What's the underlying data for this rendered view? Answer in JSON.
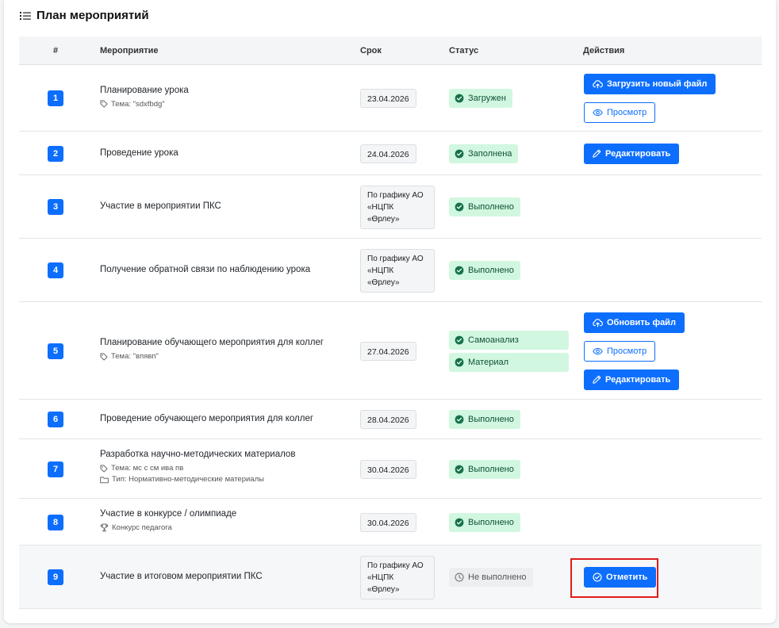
{
  "card": {
    "title": "План мероприятий"
  },
  "columns": {
    "num": "#",
    "event": "Мероприятие",
    "deadline": "Срок",
    "status": "Статус",
    "actions": "Действия"
  },
  "rows": [
    {
      "num": "1",
      "name": "Планирование урока",
      "meta": [
        {
          "icon": "tag-icon",
          "text": "Тема: \"sdxfbdg\""
        }
      ],
      "deadline": "23.04.2026",
      "statuses": [
        {
          "icon": "check-circle-icon",
          "text": "Загружен"
        }
      ],
      "actions": [
        {
          "icon": "cloud-upload-icon",
          "label": "Загрузить новый файл",
          "style": "primary"
        },
        {
          "icon": "eye-icon",
          "label": "Просмотр",
          "style": "outline"
        }
      ]
    },
    {
      "num": "2",
      "name": "Проведение урока",
      "meta": [],
      "deadline": "24.04.2026",
      "statuses": [
        {
          "icon": "check-circle-icon",
          "text": "Заполнена"
        }
      ],
      "actions": [
        {
          "icon": "pencil-icon",
          "label": "Редактировать",
          "style": "primary"
        }
      ]
    },
    {
      "num": "3",
      "name": "Участие в мероприятии ПКС",
      "meta": [],
      "deadline": "По графику АО «НЦПК «Өрлеу»",
      "statuses": [
        {
          "icon": "check-circle-icon",
          "text": "Выполнено"
        }
      ],
      "actions": []
    },
    {
      "num": "4",
      "name": "Получение обратной связи по наблюдению урока",
      "meta": [],
      "deadline": "По графику АО «НЦПК «Өрлеу»",
      "statuses": [
        {
          "icon": "check-circle-icon",
          "text": "Выполнено"
        }
      ],
      "actions": []
    },
    {
      "num": "5",
      "name": "Планирование обучающего мероприятия для коллег",
      "meta": [
        {
          "icon": "tag-icon",
          "text": "Тема: \"впявп\""
        }
      ],
      "deadline": "27.04.2026",
      "statuses": [
        {
          "icon": "check-circle-icon",
          "text": "Самоанализ"
        },
        {
          "icon": "check-circle-icon",
          "text": "Материал"
        }
      ],
      "actions": [
        {
          "icon": "cloud-upload-icon",
          "label": "Обновить файл",
          "style": "primary"
        },
        {
          "icon": "eye-icon",
          "label": "Просмотр",
          "style": "outline"
        },
        {
          "icon": "pencil-icon",
          "label": "Редактировать",
          "style": "primary"
        }
      ]
    },
    {
      "num": "6",
      "name": "Проведение обучающего мероприятия для коллег",
      "meta": [],
      "deadline": "28.04.2026",
      "statuses": [
        {
          "icon": "check-circle-icon",
          "text": "Выполнено"
        }
      ],
      "actions": []
    },
    {
      "num": "7",
      "name": "Разработка научно-методических материалов",
      "meta": [
        {
          "icon": "tag-icon",
          "text": "Тема: мс с см ива пв"
        },
        {
          "icon": "folder-icon",
          "text": "Тип: Нормативно-методические материалы"
        }
      ],
      "deadline": "30.04.2026",
      "statuses": [
        {
          "icon": "check-circle-icon",
          "text": "Выполнено"
        }
      ],
      "actions": []
    },
    {
      "num": "8",
      "name": "Участие в конкурсе / олимпиаде",
      "meta": [
        {
          "icon": "trophy-icon",
          "text": "Конкурс педагога"
        }
      ],
      "deadline": "30.04.2026",
      "statuses": [
        {
          "icon": "check-circle-icon",
          "text": "Выполнено"
        }
      ],
      "actions": []
    },
    {
      "num": "9",
      "name": "Участие в итоговом мероприятии ПКС",
      "meta": [],
      "deadline": "По графику АО «НЦПК «Өрлеу»",
      "statuses": [
        {
          "icon": "clock-icon",
          "text": "Не выполнено",
          "muted": true
        }
      ],
      "actions": [
        {
          "icon": "check-circle-icon",
          "label": "Отметить",
          "style": "primary",
          "highlighted": true
        }
      ]
    }
  ]
}
